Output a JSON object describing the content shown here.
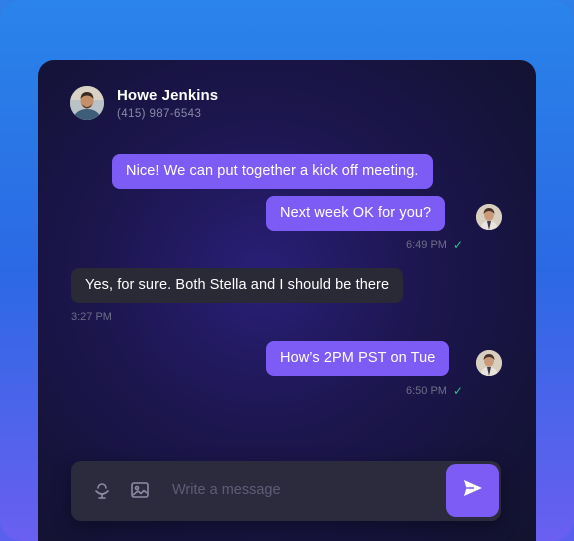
{
  "contact": {
    "name": "Howe Jenkins",
    "phone": "(415) 987-6543"
  },
  "messages": [
    {
      "text": "Nice! We can put together a kick off meeting.",
      "direction": "outgoing"
    },
    {
      "text": "Next week OK for you?",
      "direction": "outgoing",
      "time": "6:49 PM",
      "status": "delivered"
    },
    {
      "text": "Yes, for sure. Both Stella and I should be there",
      "direction": "incoming",
      "time": "3:27 PM"
    },
    {
      "text": "How’s 2PM PST on Tue",
      "direction": "outgoing",
      "time": "6:50 PM",
      "status": "delivered"
    }
  ],
  "composer": {
    "placeholder": "Write a message",
    "icons": [
      "microphone-icon",
      "image-icon",
      "send-icon"
    ]
  },
  "colors": {
    "accent": "#7d5cf6",
    "incoming_bubble": "#2a2936",
    "check": "#2fc68a"
  }
}
